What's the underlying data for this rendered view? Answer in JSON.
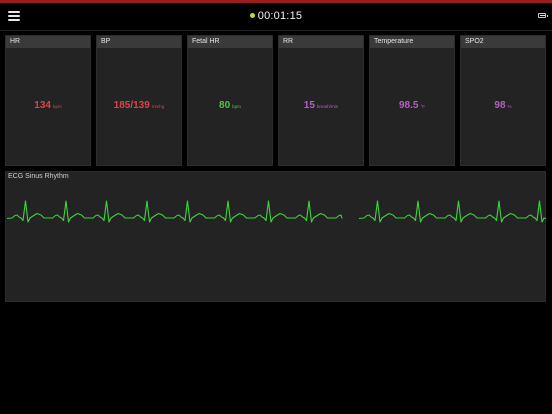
{
  "colors": {
    "top_accent": "#9b1c1c",
    "timer_dot": "#b8e02b",
    "hr": "#d9444b",
    "bp": "#d9444b",
    "fetal_hr": "#4fc24a",
    "rr": "#b65fc4",
    "temperature": "#b65fc4",
    "spo2": "#b65fc4",
    "ecg_trace": "#3ed43a"
  },
  "header": {
    "menu_icon": "hamburger-icon",
    "timer": "00:01:15",
    "battery_icon": "battery-icon"
  },
  "vitals": [
    {
      "label": "HR",
      "value": "134",
      "unit": "bpm"
    },
    {
      "label": "BP",
      "value": "185/139",
      "unit": "mmhg"
    },
    {
      "label": "Fetal HR",
      "value": "80",
      "unit": "bpm"
    },
    {
      "label": "RR",
      "value": "15",
      "unit": "breath/min"
    },
    {
      "label": "Temperature",
      "value": "98.5",
      "unit": "°F"
    },
    {
      "label": "SPO2",
      "value": "98",
      "unit": "%"
    }
  ],
  "ecg": {
    "label": "ECG Sinus Rhythm"
  }
}
